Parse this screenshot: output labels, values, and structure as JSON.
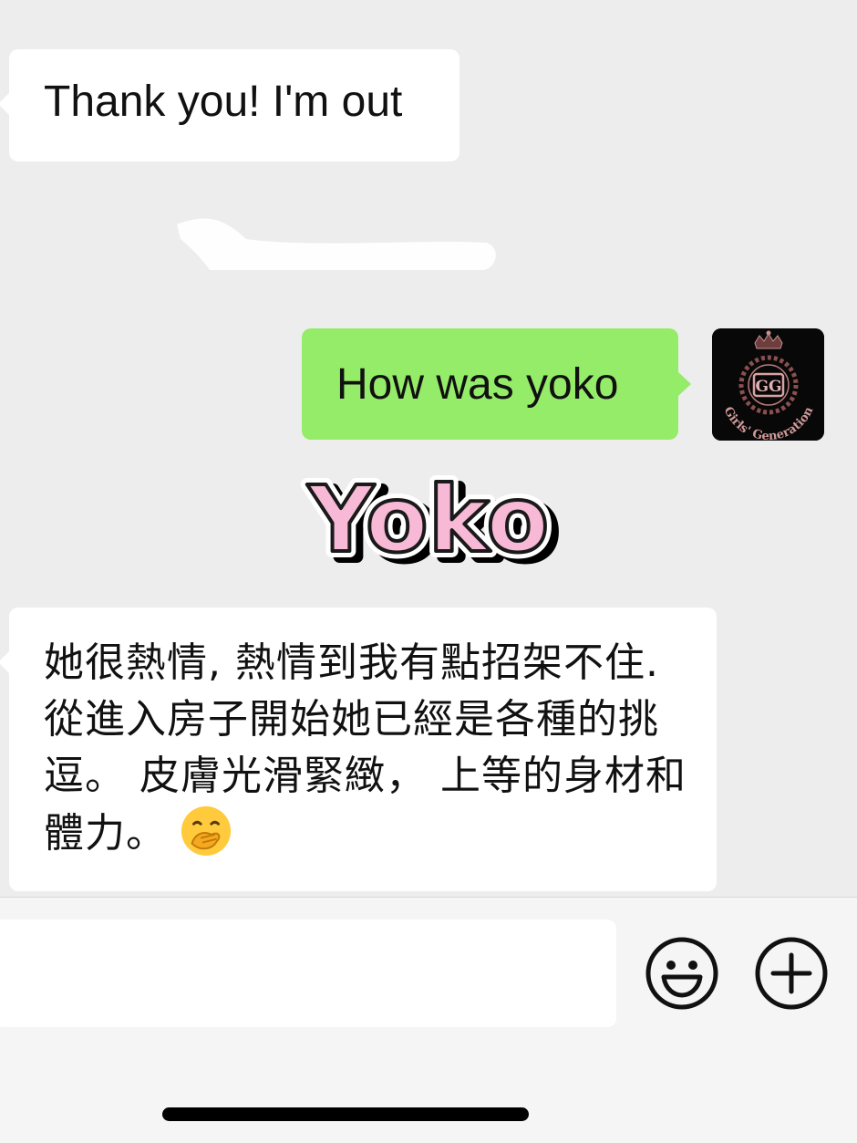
{
  "messages": [
    {
      "side": "left",
      "text": "Thank you! I'm out"
    },
    {
      "side": "right",
      "text": "How was yoko"
    },
    {
      "side": "left",
      "text": "她很熱情, 熱情到我有點招架不住. 從進入房子開始她已經是各種的挑逗。 皮膚光滑緊緻， 上等的身材和體力。"
    }
  ],
  "sticker": {
    "text": "Yoko",
    "color": "#f7b9d6"
  },
  "avatar": {
    "logo_text": "Girls' Generation",
    "monogram": "GG"
  },
  "emoji": {
    "name": "hand-over-mouth-emoji"
  },
  "input_bar": {
    "placeholder": "",
    "emoji_icon": "smiley-face-icon",
    "plus_icon": "plus-circle-icon"
  },
  "colors": {
    "background": "#ededed",
    "incoming_bubble": "#ffffff",
    "outgoing_bubble": "#95ec69",
    "input_area": "#f5f5f5"
  }
}
